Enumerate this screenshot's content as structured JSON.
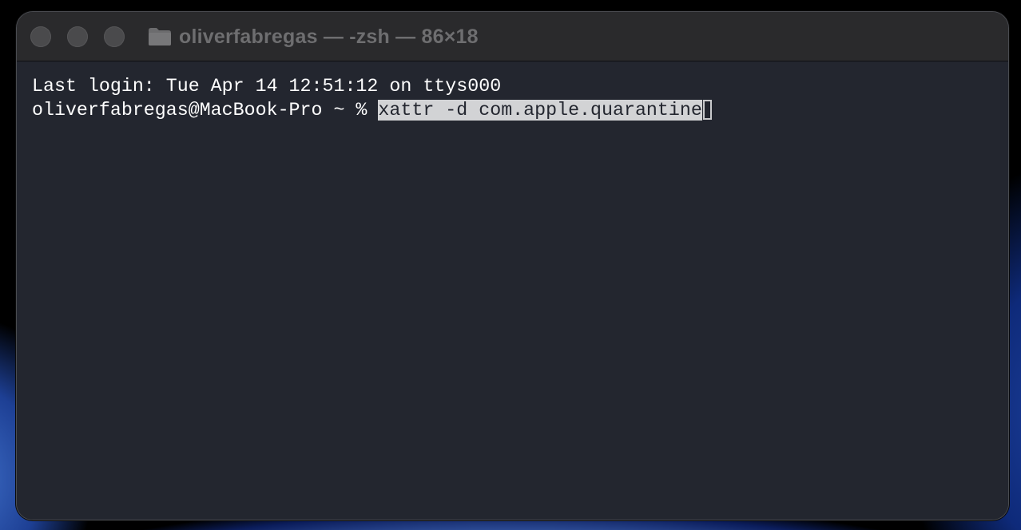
{
  "window": {
    "title": "oliverfabregas — -zsh — 86×18",
    "traffic_lights": [
      "close",
      "minimize",
      "zoom"
    ],
    "folder_icon": "folder-icon"
  },
  "terminal": {
    "last_login": "Last login: Tue Apr 14 12:51:12 on ttys000",
    "prompt": "oliverfabregas@MacBook-Pro ~ % ",
    "command": "xattr -d com.apple.quarantine"
  },
  "colors": {
    "terminal_background": "#23262f",
    "titlebar_background": "#2a2a2c",
    "text": "#ffffff",
    "selection": "#d2d3d5"
  }
}
